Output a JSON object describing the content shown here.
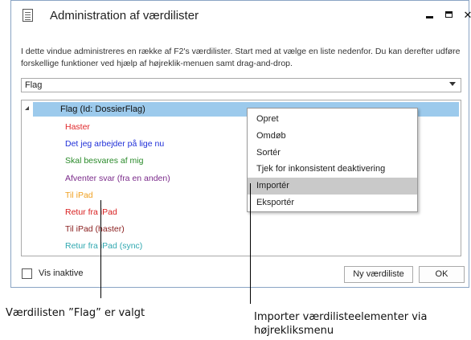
{
  "window": {
    "title": "Administration af værdilister"
  },
  "description": "I dette vindue administreres en række af F2's værdilister. Start med at vælge en liste nedenfor. Du kan derefter udføre forskellige funktioner ved hjælp af højreklik-menuen samt drag-and-drop.",
  "list_selector": {
    "value": "Flag"
  },
  "tree": {
    "root_label": "Flag (Id: DossierFlag)",
    "items": [
      {
        "label": "Haster",
        "color": "#e0282b"
      },
      {
        "label": "Det jeg arbejder på lige nu",
        "color": "#2030d8"
      },
      {
        "label": "Skal besvares af mig",
        "color": "#2a8a2a"
      },
      {
        "label": "Afventer svar (fra en anden)",
        "color": "#7a2a8a"
      },
      {
        "label": "Til iPad",
        "color": "#f0a020"
      },
      {
        "label": "Retur fra iPad",
        "color": "#d82020"
      },
      {
        "label": "Til iPad (haster)",
        "color": "#8a2020"
      },
      {
        "label": "Retur fra iPad (sync)",
        "color": "#30a8b0"
      }
    ]
  },
  "context_menu": {
    "items": [
      {
        "label": "Opret"
      },
      {
        "label": "Omdøb"
      },
      {
        "label": "Sortér"
      },
      {
        "label": "Tjek for inkonsistent deaktivering"
      },
      {
        "label": "Importér",
        "highlighted": true
      },
      {
        "label": "Eksportér"
      }
    ]
  },
  "footer": {
    "show_inactive_label": "Vis inaktive",
    "show_inactive_checked": false,
    "new_list_button": "Ny værdiliste",
    "ok_button": "OK"
  },
  "captions": {
    "left": "Værdilisten ”Flag” er valgt",
    "right_line1": "Importer værdilisteelementer via",
    "right_line2": "højrekliksmenu"
  }
}
